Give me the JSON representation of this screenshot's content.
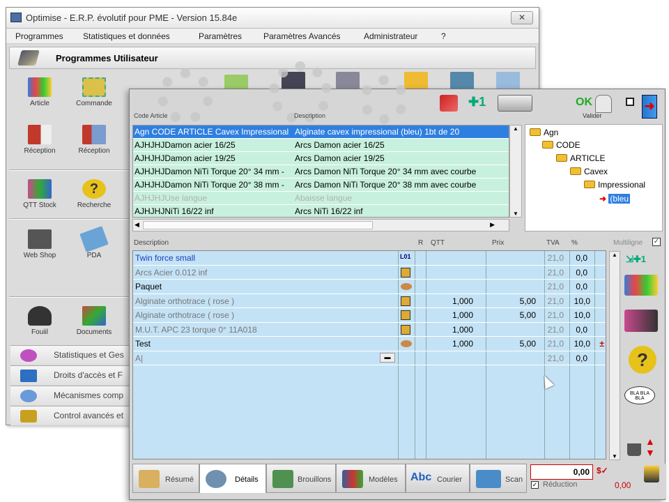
{
  "back_window": {
    "title": "Optimise - E.R.P. évolutif pour PME - Version 15.84e",
    "close_label": "✕",
    "menu": [
      "Programmes",
      "Statistiques et données",
      "Paramètres",
      "Paramètres Avancés",
      "Administrateur",
      "?"
    ],
    "section_title": "Programmes Utilisateur",
    "tiles": [
      {
        "label": "Article",
        "color": "#3a7bd5"
      },
      {
        "label": "Commande",
        "color": "#d9c14a"
      },
      {
        "label": "Réception",
        "color": "#c0392b"
      },
      {
        "label": "Réception",
        "color": "#7a9ccf"
      },
      {
        "label": "QTT Stock",
        "color": "#c94a8e"
      },
      {
        "label": "Recherche",
        "color": "#e6c21b"
      },
      {
        "label": "Web Shop",
        "color": "#555555"
      },
      {
        "label": "PDA",
        "color": "#6aa4d6"
      },
      {
        "label": "Fouiil",
        "color": "#333333"
      },
      {
        "label": "Documents",
        "color": "#c94a3e"
      }
    ],
    "list_items": [
      {
        "label": "Statistiques et Ges",
        "color": "#c050c0"
      },
      {
        "label": "Droits d'accès et F",
        "color": "#2d6fc0"
      },
      {
        "label": "Mécanismes comp",
        "color": "#6a9ad8"
      },
      {
        "label": "Control avancés et",
        "color": "#c8a020"
      }
    ]
  },
  "front_window": {
    "toolbar": {
      "ok_label": "OK",
      "valider_label": "Valider"
    },
    "articles_header": {
      "code": "Code Article",
      "description": "Description"
    },
    "articles": [
      {
        "code": "Agn CODE ARTICLE Cavex Impressional",
        "description": "Alginate cavex impressional (bleu) 1bt de 20",
        "state": "selected"
      },
      {
        "code": "AJHJHJDamon acier 16/25",
        "description": "Arcs Damon acier 16/25",
        "state": "normal"
      },
      {
        "code": "AJHJHJDamon acier 19/25",
        "description": "Arcs Damon acier 19/25",
        "state": "normal"
      },
      {
        "code": "AJHJHJDamon NiTi Torque 20° 34 mm -",
        "description": "Arcs Damon NiTi Torque 20° 34 mm avec courbe",
        "state": "normal"
      },
      {
        "code": "AJHJHJDamon NiTi Torque 20° 38 mm -",
        "description": "Arcs Damon NiTi Torque 20° 38 mm avec courbe",
        "state": "normal"
      },
      {
        "code": "AJHJHJUse langue",
        "description": "Abaisse langue",
        "state": "dim"
      },
      {
        "code": "AJHJHJNiTi 16/22 inf",
        "description": "Arcs NiTi 16/22 inf",
        "state": "normal"
      }
    ],
    "tree": [
      {
        "label": "Agn",
        "level": 0
      },
      {
        "label": "CODE",
        "level": 1
      },
      {
        "label": "ARTICLE",
        "level": 2
      },
      {
        "label": "Cavex",
        "level": 3
      },
      {
        "label": "Impressional",
        "level": 4
      },
      {
        "label": "(bleu",
        "level": 5
      }
    ],
    "lines_header": {
      "description": "Description",
      "r": "R",
      "qtt": "QTT",
      "prix": "Prix",
      "tva": "TVA",
      "pct": "%",
      "multiligne": "Multiligne"
    },
    "lines": [
      {
        "description": "Twin force small",
        "tag": "L01",
        "qtt": "",
        "prix": "",
        "tva": "21,0",
        "pct": "0,0",
        "style": "blue"
      },
      {
        "description": "Arcs Acier 0.012 inf",
        "tag": "",
        "qtt": "",
        "prix": "",
        "tva": "21,0",
        "pct": "0,0",
        "style": "grey"
      },
      {
        "description": "Paquet",
        "tag": "",
        "qtt": "",
        "prix": "",
        "tva": "21,0",
        "pct": "0,0",
        "style": "black"
      },
      {
        "description": "Alginate orthotrace ( rose )",
        "tag": "",
        "qtt": "1,000",
        "prix": "5,00",
        "tva": "21,0",
        "pct": "10,0",
        "style": "grey"
      },
      {
        "description": "Alginate orthotrace ( rose )",
        "tag": "",
        "qtt": "1,000",
        "prix": "5,00",
        "tva": "21,0",
        "pct": "10,0",
        "style": "grey"
      },
      {
        "description": "M.U.T. APC 23 torque 0° 11A018",
        "tag": "",
        "qtt": "1,000",
        "prix": "",
        "tva": "21,0",
        "pct": "0,0",
        "style": "grey"
      },
      {
        "description": "Test",
        "tag": "",
        "qtt": "1,000",
        "prix": "5,00",
        "tva": "21,0",
        "pct": "10,0",
        "style": "black"
      },
      {
        "description": "A|",
        "tag": "",
        "qtt": "",
        "prix": "",
        "tva": "21,0",
        "pct": "0,0",
        "style": "grey"
      }
    ],
    "side_tag": "BLA BLA BLA",
    "tabs": [
      {
        "label": "Résumé",
        "color": "#d8b060"
      },
      {
        "label": "Détails",
        "color": "#7090b0",
        "active": true
      },
      {
        "label": "Brouillons",
        "color": "#509050"
      },
      {
        "label": "Modèles",
        "color": "#3060a0"
      },
      {
        "label": "Courier",
        "color": "#2060c0",
        "prefix": "Abc"
      },
      {
        "label": "Scan",
        "color": "#4a8cc8"
      }
    ],
    "total": "0,00",
    "reduction_label": "Réduction",
    "reduction_value": "0,00"
  }
}
